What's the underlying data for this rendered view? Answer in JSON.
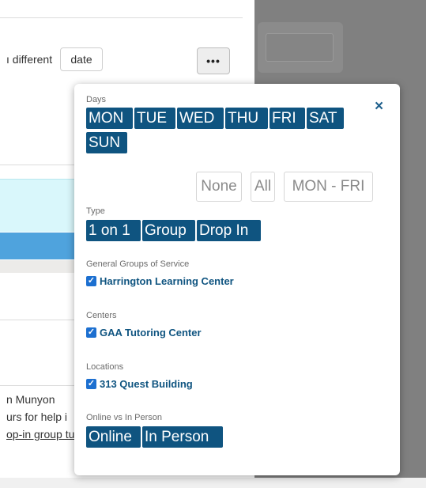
{
  "background": {
    "different_text": "ı different",
    "date_button": "date",
    "more_button": "•••",
    "name_text": "n Munyon",
    "hours_text": "urs for help i",
    "dropin_text": "op-in group tu"
  },
  "popover": {
    "close_label": "×",
    "days": {
      "label": "Days",
      "options": [
        "MON",
        "TUE",
        "WED",
        "THU",
        "FRI",
        "SAT",
        "SUN"
      ],
      "none_button": "None",
      "all_button": "All",
      "weekdays_button": "MON - FRI"
    },
    "type": {
      "label": "Type",
      "options": [
        "1 on 1",
        "Group",
        "Drop In"
      ]
    },
    "groups": {
      "label": "General Groups of Service",
      "items": [
        {
          "label": "Harrington Learning Center",
          "checked": true
        }
      ]
    },
    "centers": {
      "label": "Centers",
      "items": [
        {
          "label": "GAA Tutoring Center",
          "checked": true
        }
      ]
    },
    "locations": {
      "label": "Locations",
      "items": [
        {
          "label": "313 Quest Building",
          "checked": true
        }
      ]
    },
    "mode": {
      "label": "Online vs In Person",
      "options": [
        "Online",
        "In Person"
      ]
    }
  },
  "colors": {
    "tag_bg": "#0f5480",
    "checkbox": "#1c6fd0",
    "overlay": "#808080"
  }
}
